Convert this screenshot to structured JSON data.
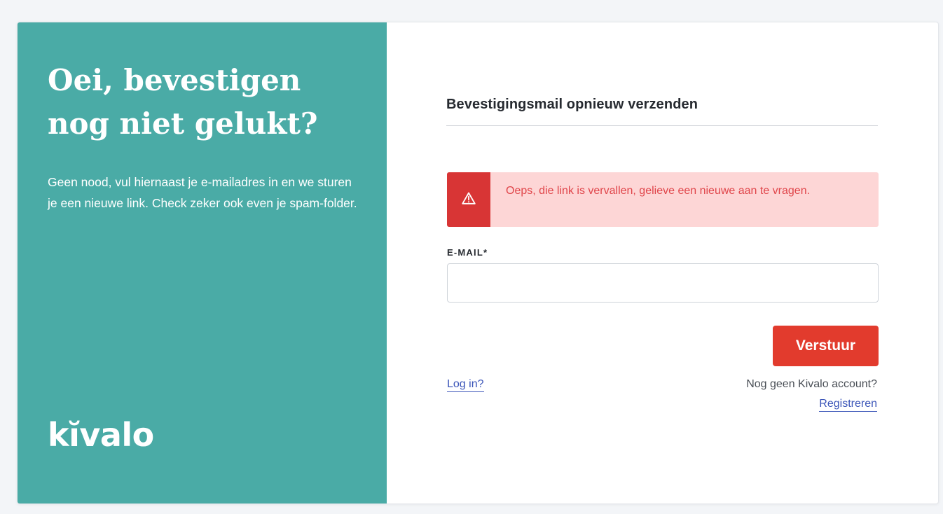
{
  "left": {
    "title": "Oei, bevestigen nog niet gelukt?",
    "body": "Geen nood, vul hiernaast je e-mailadres in en we sturen je een nieuwe link. Check zeker ook even je spam-folder.",
    "logo_text": "kĭvalo"
  },
  "form": {
    "heading": "Bevestigingsmail opnieuw verzenden",
    "alert": {
      "icon": "warning-triangle-icon",
      "message": "Oeps, die link is vervallen, gelieve een nieuwe aan te vragen."
    },
    "email_label": "E-MAIL*",
    "email_value": "",
    "submit_label": "Verstuur",
    "login_link": "Log in?",
    "register_question": "Nog geen Kivalo account?",
    "register_link": "Registreren"
  },
  "colors": {
    "left_panel": "#4aaba6",
    "alert_bg": "#fdd6d6",
    "alert_icon_bg": "#d83535",
    "alert_text": "#e0454a",
    "button": "#e23b2d",
    "link": "#3b55b8"
  }
}
